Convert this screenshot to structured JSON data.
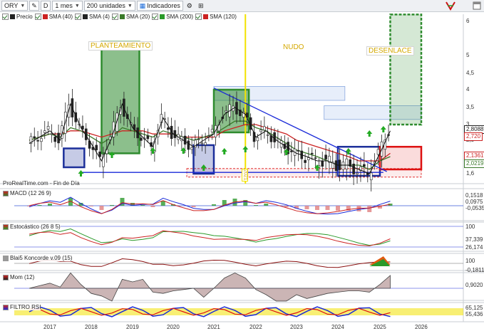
{
  "toolbar": {
    "symbol": "ORY",
    "d_label": "D",
    "period": "1 mes",
    "units": "200 unidades",
    "indicators": "Indicadores"
  },
  "legend": [
    {
      "label": "Precio",
      "color": "#222222"
    },
    {
      "label": "SMA (40)",
      "color": "#cc2222"
    },
    {
      "label": "SMA (4)",
      "color": "#222222"
    },
    {
      "label": "SMA (20)",
      "color": "#3a7a2a"
    },
    {
      "label": "SMA (200)",
      "color": "#2a9a2a"
    },
    {
      "label": "SMA (120)",
      "color": "#cc2222"
    }
  ],
  "annotations": {
    "planteamiento": "PLANTEAMIENTO",
    "nudo": "NUDO",
    "desenlace": "DESENLACE",
    "source": "ProRealTime.com - Fin de Día"
  },
  "price_axis": [
    "6",
    "5",
    "4,5",
    "4",
    "3,5",
    "3",
    "2,5",
    "2",
    "1,6"
  ],
  "price_tags": [
    {
      "text": "2,8088",
      "color": "#222222"
    },
    {
      "text": "2,720",
      "color": "#cc2222"
    },
    {
      "text": "2,1361",
      "color": "#cc2222"
    },
    {
      "text": "2,0219",
      "color": "#3a7a2a"
    }
  ],
  "panels": {
    "macd": {
      "label": "MACD (12 26 9)",
      "tags": [
        "0,1518",
        "0,0975",
        "-0,0535"
      ]
    },
    "stoch": {
      "label": "Estocástico (26 8 5)",
      "tags": [
        "100",
        "37,339",
        "26,174"
      ]
    },
    "blai5": {
      "label": "Blai5 Koncorde v.09 (15)",
      "tags": [
        "100",
        "-0,1811"
      ]
    },
    "mom": {
      "label": "Mom (12)",
      "tags": [
        "0,9020"
      ]
    },
    "rsi": {
      "label": "FILTRO RSI",
      "tags": [
        "65,125",
        "55,436"
      ]
    }
  },
  "x_axis": [
    "2017",
    "2018",
    "2019",
    "2020",
    "2021",
    "2022",
    "2023",
    "2024",
    "2025",
    "2026"
  ],
  "vertical_marker_label": "2021",
  "colors": {
    "accent_green": "#2e8b2e",
    "box_blue": "#1c2f9a",
    "box_red": "#dd1111",
    "trend_blue": "#1a2ad8",
    "highlight_yellow": "#f2e200"
  },
  "chart_data": {
    "type": "candlestick",
    "title": "ORY",
    "x": [
      "2016-07",
      "2016-10",
      "2017-01",
      "2017-04",
      "2017-07",
      "2017-10",
      "2018-01",
      "2018-04",
      "2018-07",
      "2018-10",
      "2019-01",
      "2019-04",
      "2019-07",
      "2019-10",
      "2020-01",
      "2020-04",
      "2020-07",
      "2020-10",
      "2021-01",
      "2021-04",
      "2021-07",
      "2021-10",
      "2022-01",
      "2022-04",
      "2022-07",
      "2022-10",
      "2023-01",
      "2023-04",
      "2023-07",
      "2023-10",
      "2024-01",
      "2024-04",
      "2024-07",
      "2024-10",
      "2025-01",
      "2025-04"
    ],
    "close": [
      2.4,
      2.6,
      2.8,
      2.5,
      3.6,
      2.9,
      2.4,
      1.9,
      2.6,
      3.6,
      2.9,
      2.6,
      2.3,
      3.2,
      2.7,
      2.5,
      2.3,
      2.5,
      2.7,
      3.3,
      3.5,
      3.3,
      2.6,
      2.8,
      2.5,
      2.3,
      2.1,
      2.0,
      1.9,
      1.9,
      1.8,
      1.8,
      1.7,
      1.6,
      2.1,
      2.8
    ],
    "ylim": [
      1.5,
      6.2
    ],
    "series": [
      {
        "name": "SMA (40)",
        "values": [
          2.5,
          2.6,
          2.7,
          2.7,
          2.8,
          2.8,
          2.7,
          2.6,
          2.7,
          2.8,
          2.8,
          2.8,
          2.7,
          2.7,
          2.7,
          2.6,
          2.6,
          2.6,
          2.6,
          2.8,
          2.9,
          3.0,
          3.0,
          2.9,
          2.8,
          2.7,
          2.5,
          2.4,
          2.3,
          2.2,
          2.1,
          2.0,
          1.9,
          1.9,
          1.9,
          2.1
        ]
      },
      {
        "name": "SMA (20)",
        "values": [
          2.5,
          2.6,
          2.7,
          2.6,
          2.9,
          2.8,
          2.6,
          2.4,
          2.6,
          2.9,
          2.8,
          2.7,
          2.6,
          2.8,
          2.7,
          2.6,
          2.5,
          2.6,
          2.7,
          2.9,
          3.1,
          3.1,
          2.9,
          2.8,
          2.6,
          2.4,
          2.2,
          2.1,
          2.0,
          1.9,
          1.8,
          1.8,
          1.8,
          1.7,
          1.9,
          2.0
        ]
      }
    ],
    "legend": "top-left",
    "grid": false
  }
}
